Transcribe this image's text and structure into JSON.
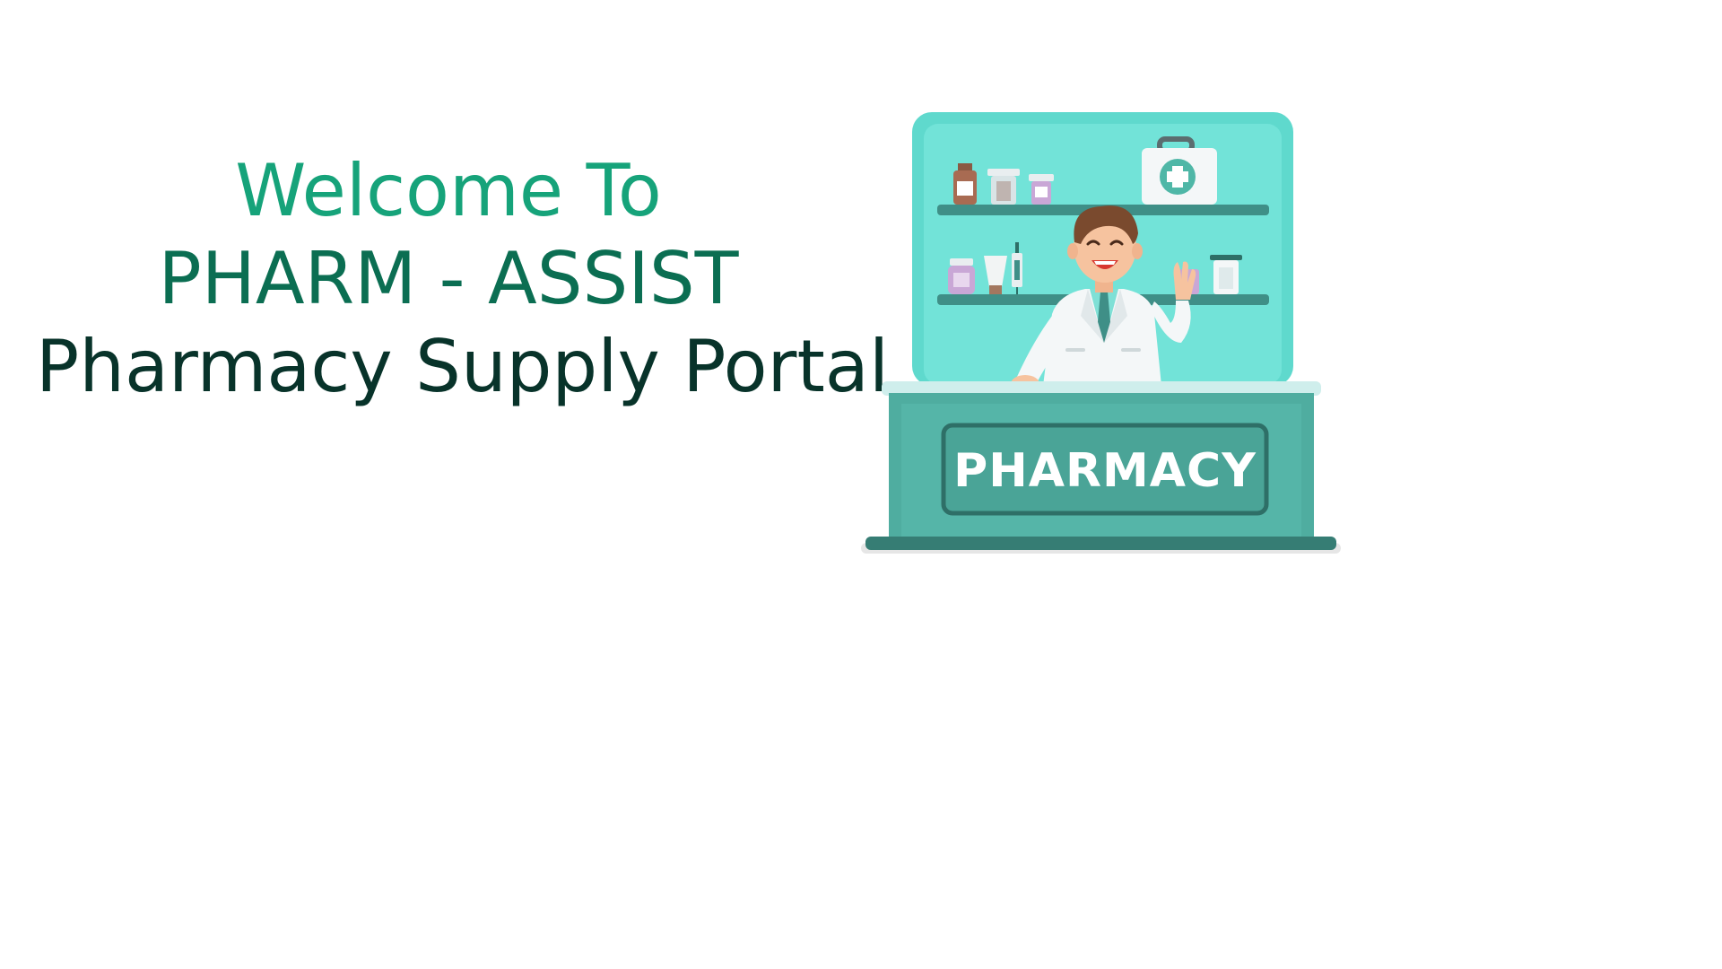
{
  "welcome": {
    "line1": "Welcome To",
    "line2": "PHARM - ASSIST",
    "line3": "Pharmacy Supply Portal"
  },
  "illustration": {
    "sign_label": "PHARMACY",
    "icons": [
      "first-aid-kit-icon",
      "pharmacist-icon",
      "medicine-bottle-icon",
      "syringe-icon"
    ]
  },
  "colors": {
    "title_light": "#16a37a",
    "title_mid": "#0b6e52",
    "title_dark": "#08332a",
    "cabinet": "#6fe0d4",
    "counter": "#4fada0"
  }
}
